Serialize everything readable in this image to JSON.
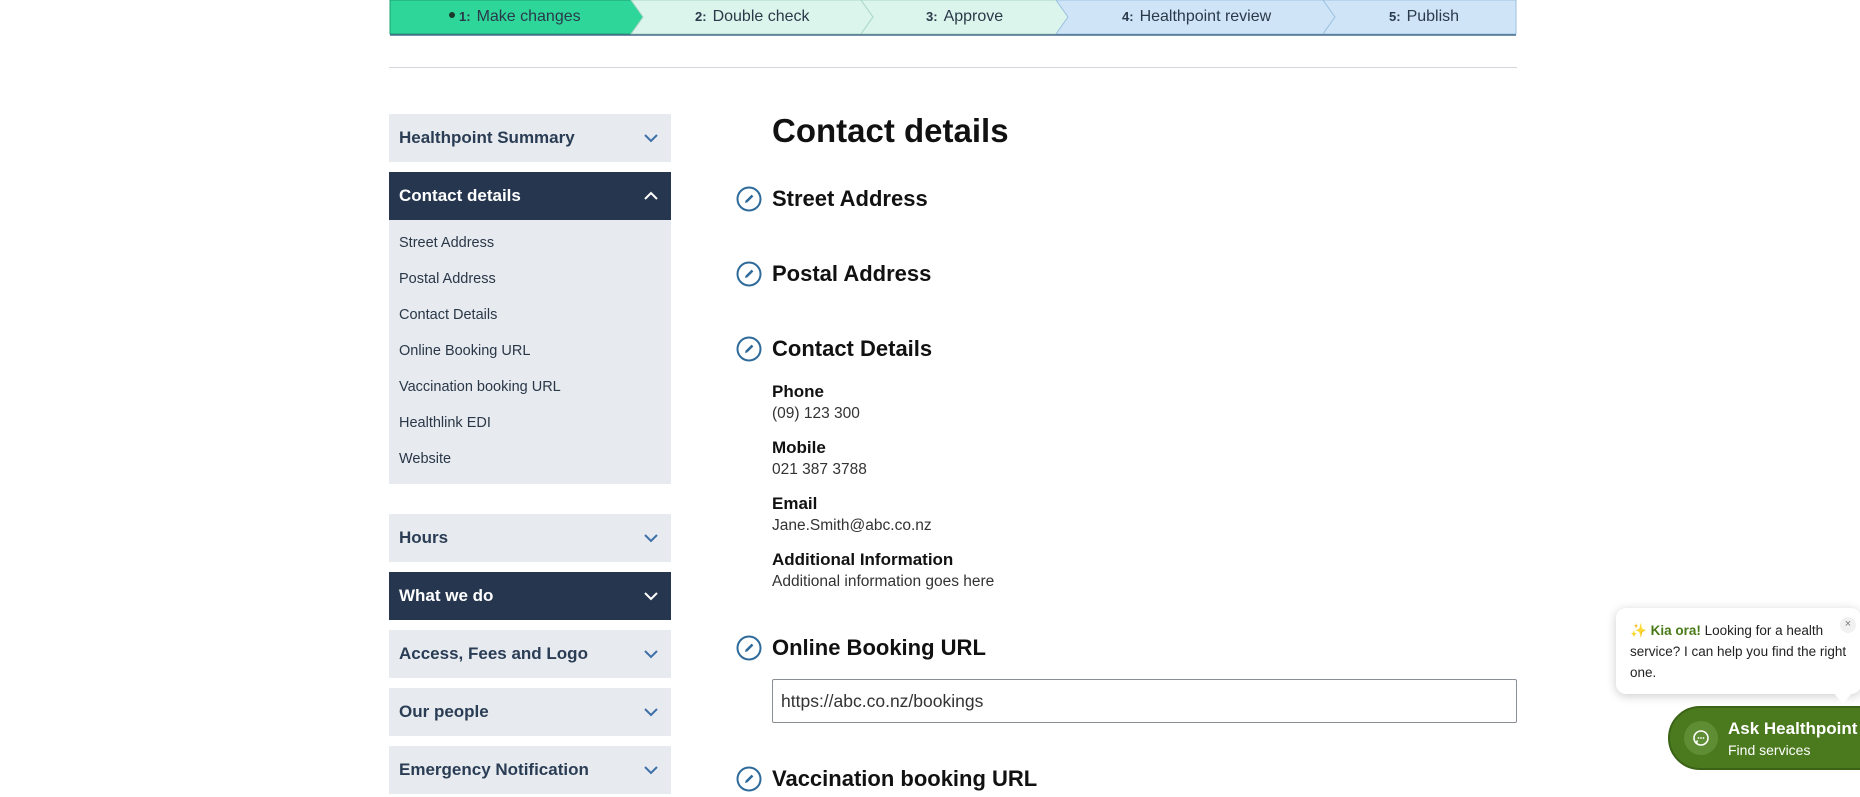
{
  "progress": {
    "steps": [
      {
        "num": "1:",
        "label": "Make changes"
      },
      {
        "num": "2:",
        "label": "Double check"
      },
      {
        "num": "3:",
        "label": "Approve"
      },
      {
        "num": "4:",
        "label": "Healthpoint review"
      },
      {
        "num": "5:",
        "label": "Publish"
      }
    ],
    "current_step": 1,
    "colors": {
      "active": "#2fd69a",
      "green_light": "#dcf5ec",
      "blue_light": "#cfe5f7"
    }
  },
  "sidebar": {
    "sections": [
      {
        "label": "Healthpoint Summary",
        "state": "collapsed"
      },
      {
        "label": "Contact details",
        "state": "expanded"
      },
      {
        "label": "Hours",
        "state": "collapsed"
      },
      {
        "label": "What we do",
        "state": "collapsed-highlighted"
      },
      {
        "label": "Access, Fees and Logo",
        "state": "collapsed"
      },
      {
        "label": "Our people",
        "state": "collapsed"
      },
      {
        "label": "Emergency Notification",
        "state": "collapsed"
      }
    ],
    "contact_items": [
      "Street Address",
      "Postal Address",
      "Contact Details",
      "Online Booking URL",
      "Vaccination booking URL",
      "Healthlink EDI",
      "Website"
    ],
    "colors": {
      "dark": "#26364f",
      "light": "#e7ebef"
    }
  },
  "main": {
    "title": "Contact details",
    "sections": {
      "street": "Street Address",
      "postal": "Postal Address",
      "contact": "Contact Details",
      "online_booking": "Online Booking URL",
      "vaccination": "Vaccination booking URL"
    },
    "fields": {
      "phone_label": "Phone",
      "phone_value": "(09) 123 300",
      "mobile_label": "Mobile",
      "mobile_value": "021 387 3788",
      "email_label": "Email",
      "email_value": "Jane.Smith@abc.co.nz",
      "additional_label": "Additional Information",
      "additional_value": "Additional information goes here"
    },
    "online_booking_url": "https://abc.co.nz/bookings"
  },
  "chat": {
    "greeting_emoji": "✨",
    "greeting_bold": "Kia ora!",
    "greeting_text": " Looking for a health service? I can help you find the right one.",
    "close_glyph": "×",
    "button_title": "Ask Healthpoint",
    "button_subtitle": "Find services",
    "accent": "#4b7a1e"
  }
}
